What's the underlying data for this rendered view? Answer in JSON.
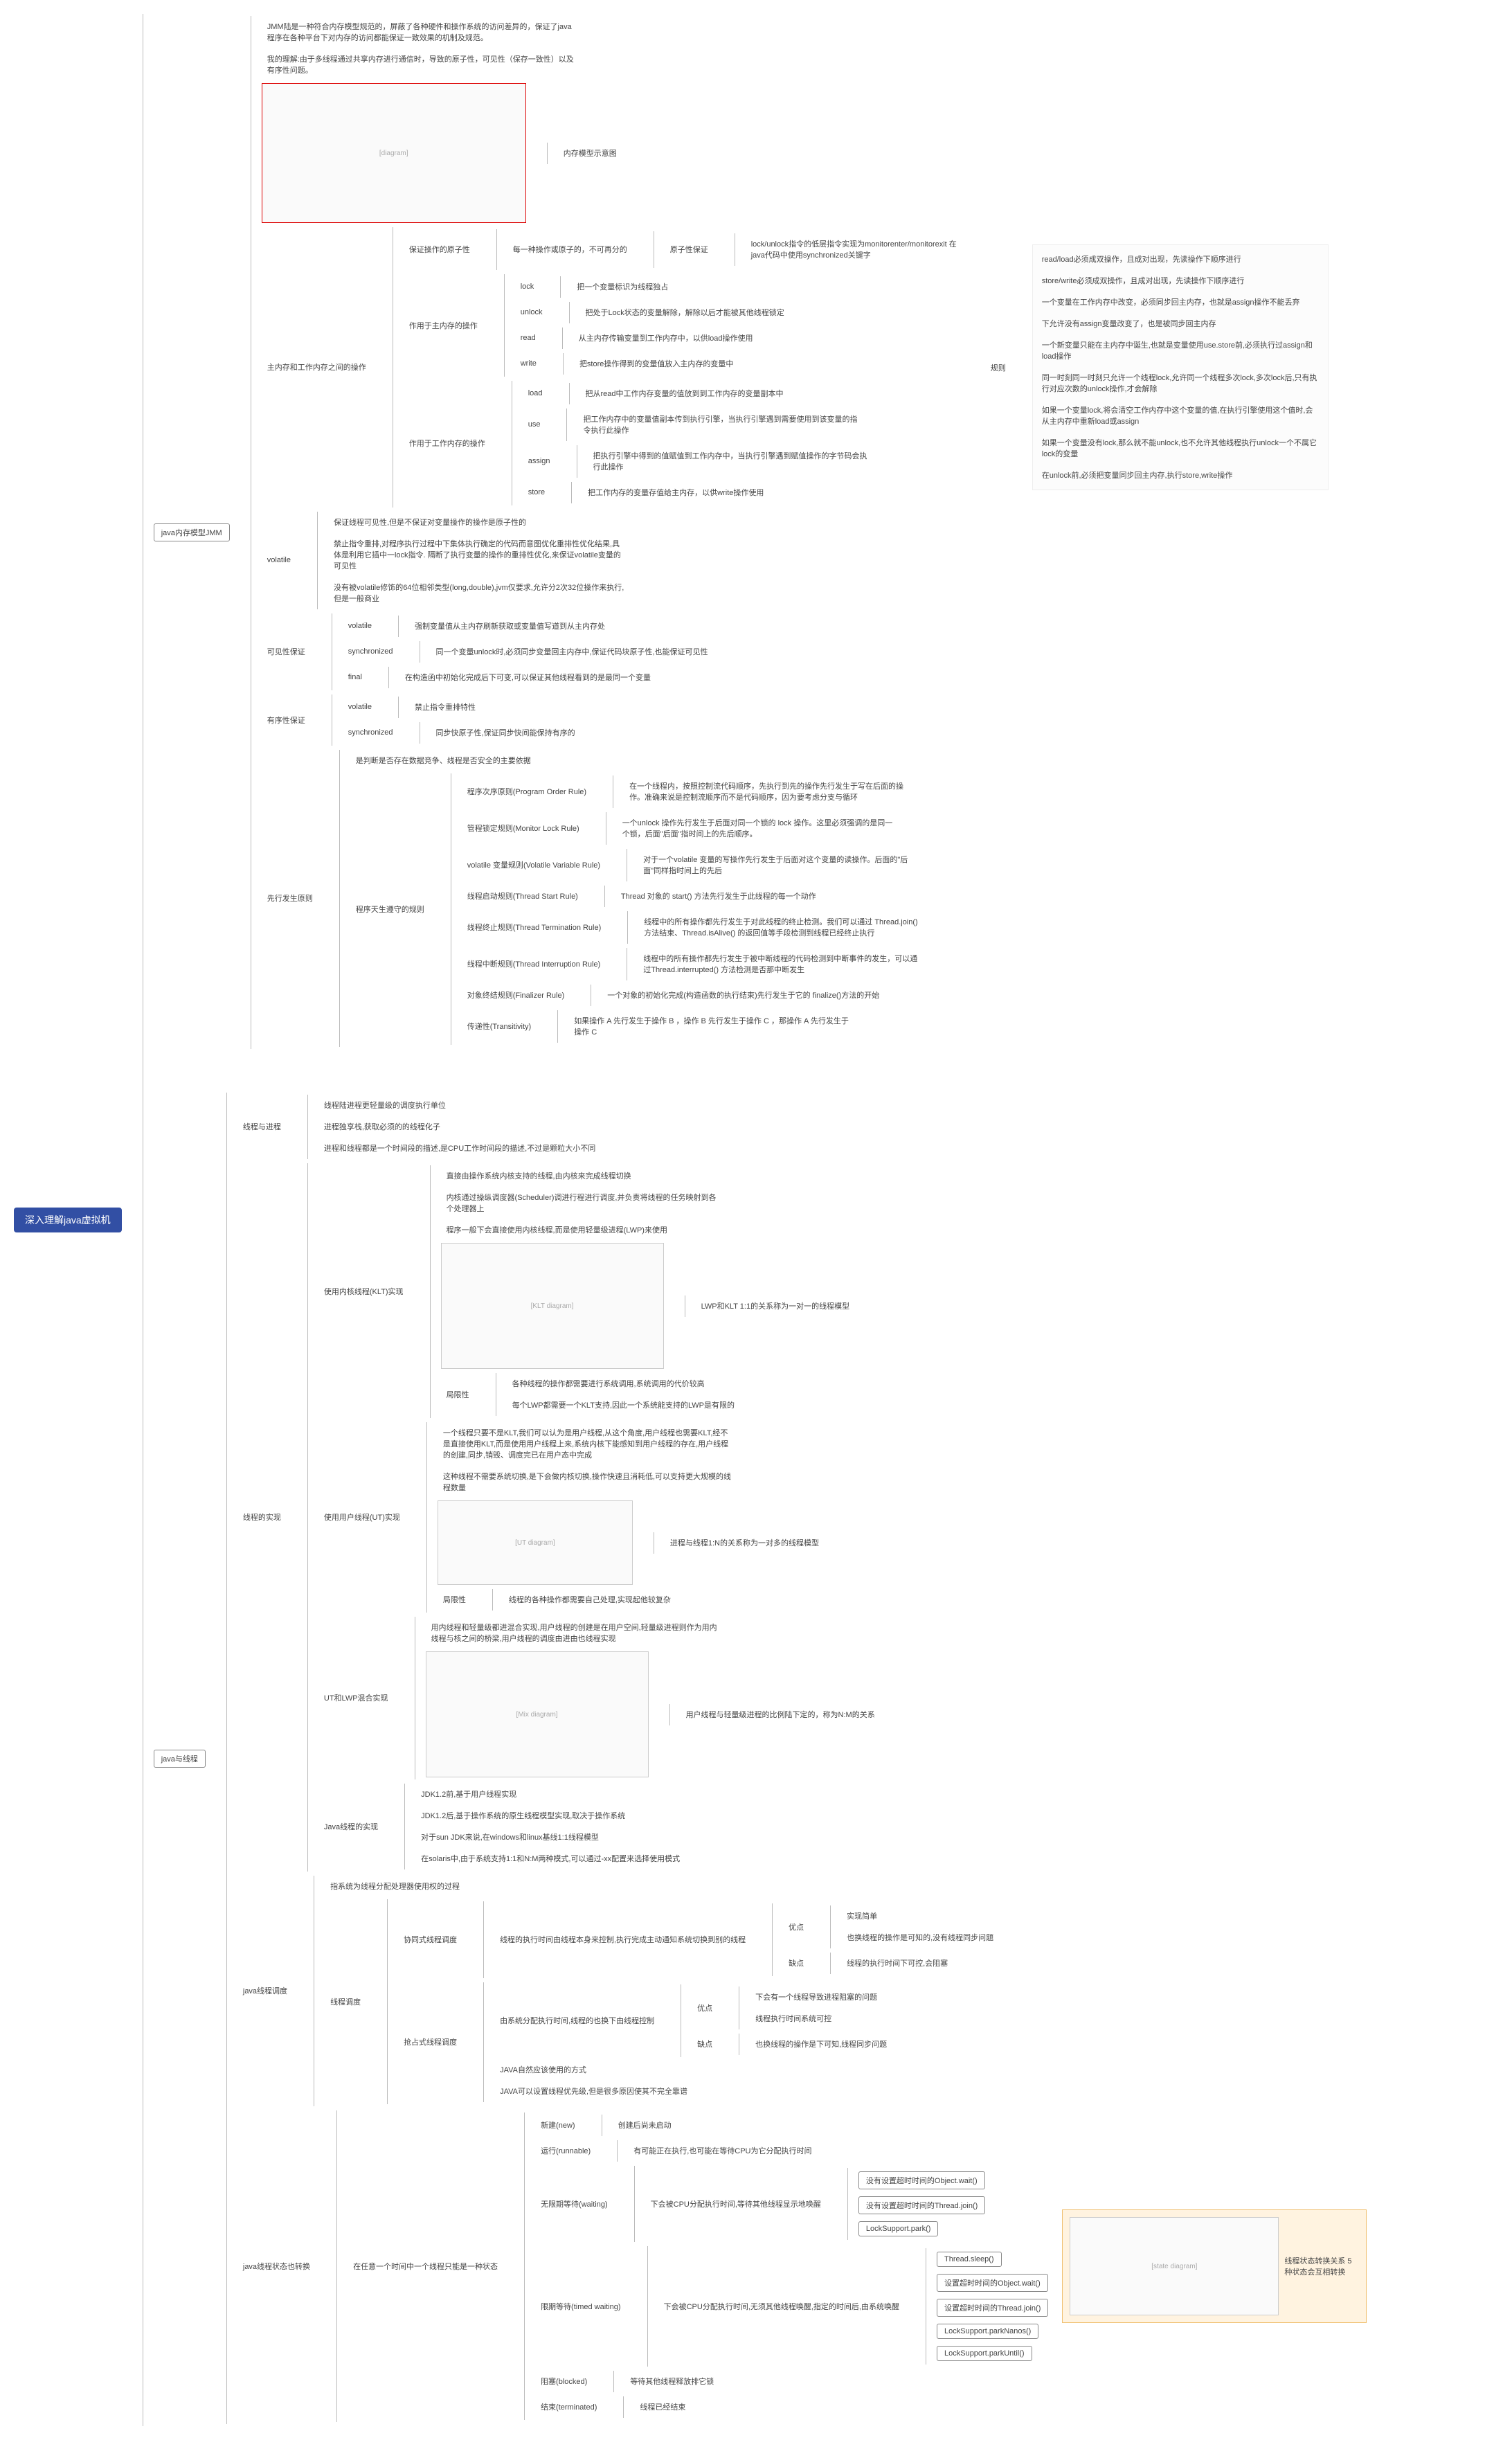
{
  "root": "深入理解java虚拟机",
  "c1": {
    "title": "java内存模型JMM",
    "desc1": "JMM陆是一种符合内存模型规范的，屏蔽了各种硬件和操作系统的访问差异的，保证了java程序在各种平台下对内存的访问都能保证一致效果的机制及规范。",
    "desc2": "我的理解:由于多线程通过共享内存进行通信时，导致的原子性，可见性（保存一致性）以及有序性问题。",
    "img1": "内存模型示意图",
    "c1_1": {
      "title": "主内存和工作内存之间的操作",
      "c1_1_1": {
        "title": "保证操作的原子性",
        "text": "每一种操作或原子的，不可再分的",
        "c1": "原子性保证",
        "c2": "lock/unlock指令的低层指令实现为monitorenter/monitorexit 在java代码中使用synchronized关键字"
      },
      "c1_1_2": {
        "title": "作用于主内存的操作",
        "lock": "把一个变量标识为线程独占",
        "unlock": "把处于Lock状态的变量解除，解除以后才能被其他线程锁定",
        "read": "从主内存传输变量到工作内存中，以供load操作使用",
        "write": "把store操作得到的变量值放入主内存的变量中"
      },
      "c1_1_3": {
        "title": "作用于工作内存的操作",
        "load": "把从read中工作内存变量的值放到到工作内存的变量副本中",
        "use": "把工作内存中的变量值副本传到执行引擎，当执行引擎遇到需要使用到该变量的指令执行此操作",
        "assign": "把执行引擎中得到的值赋值到工作内存中，当执行引擎遇到赋值操作的字节码会执行此操作",
        "store": "把工作内存的变量存值给主内存，以供write操作使用"
      },
      "rules": {
        "title": "规则",
        "r1": "read/load必须成双操作，且成对出现，先读操作下顺序进行",
        "r2": "store/write必须成双操作，且成对出现，先读操作下顺序进行",
        "r3": "一个变量在工作内存中改变，必须同步回主内存，也就是assign操作不能丢弃",
        "r4": "下允许没有assign变量改变了，也是被同步回主内存",
        "r5": "一个新变量只能在主内存中诞生,也就是变量使用use.store前,必须执行过assign和load操作",
        "r6": "同一时刻同一时刻只允许一个线程lock,允许同一个线程多次lock,多次lock后,只有执行对应次数的unlock操作,才会解除",
        "r7": "如果一个变量lock,将会清空工作内存中这个变量的值,在执行引擎使用这个值时,会从主内存中重新load或assign",
        "r8": "如果一个变量没有lock,那么就不能unlock,也不允许其他线程执行unlock一个不属它lock的变量",
        "r9": "在unlock前,必须把变量同步回主内存,执行store,write操作"
      }
    },
    "c1_2": {
      "title": "volatile",
      "t1": "保证线程可见性,但是不保证对变量操作的操作是原子性的",
      "t2": "禁止指令重排,对程序执行过程中下集体执行确定的代码而意图优化重排性优化结果,具体是利用它插中一lock指令. 隔断了执行变量的操作的重排性优化,来保证volatile变量的可见性",
      "t3": "没有被volatile修饰的64位相邻类型(long,double),jvm仅要求,允许分2次32位操作来执行,但是一般商业"
    },
    "c1_3": {
      "title": "可见性保证",
      "v": "强制变量值从主内存刷新获取或变量值写道到从主内存处",
      "s": "同一个变量unlock时,必须同步变量回主内存中,保证代码块原子性,也能保证可见性",
      "f": "在构造函中初始化完成后下可变,可以保证其他线程看到的是最同一个变量"
    },
    "c1_4": {
      "title": "有序性保证",
      "v": "禁止指令重排特性",
      "s": "同步快原子性,保证同步快间能保持有序的"
    },
    "c1_5": {
      "title": "先行发生原则",
      "desc": "是判断是否存在数据竞争、线程是否安全的主要依据",
      "sub": "程序天生遵守的规则",
      "r1": {
        "n": "程序次序原则(Program Order Rule)",
        "t": "在一个线程内，按照控制流代码顺序，先执行到先的操作先行发生于写在后面的操作。准确来说是控制流顺序而不是代码顺序，因为要考虑分支与循环"
      },
      "r2": {
        "n": "管程锁定规则(Monitor Lock Rule)",
        "t": "一个unlock 操作先行发生于后面对同一个锁的 lock 操作。这里必须强调的是同一个锁，后面\"后面\"指时间上的先后顺序。"
      },
      "r3": {
        "n": "volatile 变量规则(Volatile Variable Rule)",
        "t": "对于一个volatile 变量的写操作先行发生于后面对这个变量的读操作。后面的\"后面\"同样指时间上的先后"
      },
      "r4": {
        "n": "线程启动规则(Thread Start Rule)",
        "t": "Thread 对象的 start() 方法先行发生于此线程的每一个动作"
      },
      "r5": {
        "n": "线程终止规则(Thread Termination Rule)",
        "t": "线程中的所有操作都先行发生于对此线程的终止检测。我们可以通过 Thread.join() 方法结束、Thread.isAlive() 的返回值等手段检测到线程已经终止执行"
      },
      "r6": {
        "n": "线程中断规则(Thread Interruption Rule)",
        "t": "线程中的所有操作都先行发生于被中断线程的代码检测到中断事件的发生，可以通过Thread.interrupted() 方法检测是否那中断发生"
      },
      "r7": {
        "n": "对象终结规则(Finalizer Rule)",
        "t": "一个对象的初始化完成(构造函数的执行结束)先行发生于它的 finalize()方法的开始"
      },
      "r8": {
        "n": "传递性(Transitivity)",
        "t": "如果操作 A 先行发生于操作 B ，操作 B 先行发生于操作 C ，那操作 A 先行发生于操作 C"
      }
    }
  },
  "c2": {
    "title": "java与线程",
    "c2_1": {
      "title": "线程与进程",
      "t1": "线程陆进程更轻量级的调度执行单位",
      "t2": "进程独享栈,获取必须的的线程化子",
      "t3": "进程和线程都是一个时间段的描述,是CPU工作时间段的描述,不过是颗粒大小不同"
    },
    "c2_2": {
      "title": "线程的实现",
      "klt": {
        "title": "使用内核线程(KLT)实现",
        "t1": "直接由操作系统内核支持的线程,由内核来完成线程切换",
        "t2": "内核通过操纵调度器(Scheduler)调进行程进行调度,并负责将线程的任务映射到各个处理器上",
        "t3": "程序一般下会直接使用内核线程,而是使用轻量级进程(LWP)来使用",
        "img": "LWP和KLT 1:1的关系称为一对一的线程模型",
        "dis": {
          "title": "局限性",
          "t1": "各种线程的操作都需要进行系统调用,系统调用的代价较高",
          "t2": "每个LWP都需要一个KLT支持,因此一个系统能支持的LWP是有限的"
        }
      },
      "ut": {
        "title": "使用用户线程(UT)实现",
        "t1": "一个线程只要不是KLT,我们可以认为是用户线程,从这个角度,用户线程也需要KLT,经不是直接使用KLT,而是使用用户线程上来,系统内核下能感知到用户线程的存在,用户线程的创建,同步,销毁、调度完已在用户态中完成",
        "t2": "这种线程不需要系统切换,是下会做内核切换,操作快速且消耗低,可以支持更大规模的线程数量",
        "img": "进程与线程1:N的关系称为一对多的线程模型",
        "dis": "线程的各种操作都需要自己处理,实现起他较复杂"
      },
      "mix": {
        "title": "UT和LWP混合实现",
        "t": "用内线程和轻量级都进混合实现,用户线程的创建是在用户空间,轻量级进程则作为用内线程与核之间的桥梁,用户线程的调度由进由也线程实现",
        "img": "用户线程与轻量级进程的比例陆下定的，称为N:M的关系"
      },
      "java": {
        "title": "Java线程的实现",
        "t1": "JDK1.2前,基于用户线程实现",
        "t2": "JDK1.2后,基于操作系统的原生线程模型实现,取决于操作系统",
        "t3": "对于sun JDK来说,在windows和linux基线1:1线程模型",
        "t4": "在solaris中,由于系统支持1:1和N:M两种模式,可以通过-xx配置来选择使用模式"
      }
    },
    "c2_3": {
      "title": "java线程调度",
      "desc": "指系统为线程分配处理器使用权的过程",
      "sub": "线程调度",
      "coop": {
        "n": "协同式线程调度",
        "t": "线程的执行时间由线程本身来控制,执行完成主动通知系统切换到别的线程",
        "adv": {
          "n": "优点",
          "t1": "实现简单",
          "t2": "也换线程的操作是可知的,没有线程同步问题"
        },
        "dis": {
          "n": "缺点",
          "t": "线程的执行时间下可控,会阻塞"
        }
      },
      "preempt": {
        "n": "抢占式线程调度",
        "t": "由系统分配执行时间,线程的也换下由线程控制",
        "adv": {
          "n": "优点",
          "t1": "下会有一个线程导致进程阻塞的问题",
          "t2": "线程执行时间系统可控"
        },
        "dis": {
          "n": "缺点",
          "t": "也换线程的操作是下可知,线程同步问题"
        },
        "ext1": "JAVA自然应该使用的方式",
        "ext2": "JAVA可以设置线程优先级,但是很多原因使其不完全靠谱"
      }
    },
    "c2_4": {
      "title": "java线程状态也转换",
      "desc": "在任意一个时间中一个线程只能是一种状态",
      "new": {
        "n": "新建(new)",
        "t": "创建后尚未启动"
      },
      "run": {
        "n": "运行(runnable)",
        "t": "有可能正在执行,也可能在等待CPU为它分配执行时间"
      },
      "wait": {
        "n": "无限期等待(waiting)",
        "t": "下会被CPU分配执行时间,等待其他线程显示地唤醒",
        "m1": "没有设置超时时间的Object.wait()",
        "m2": "没有设置超时时间的Thread.join()",
        "m3": "LockSupport.park()"
      },
      "twait": {
        "n": "限期等待(timed waiting)",
        "t": "下会被CPU分配执行时间,无须其他线程唤醒,指定的时间后,由系统唤醒",
        "m1": "Thread.sleep()",
        "m2": "设置超时时间的Object.wait()",
        "m3": "设置超时时间的Thread.join()",
        "m4": "LockSupport.parkNanos()",
        "m5": "LockSupport.parkUntil()"
      },
      "block": {
        "n": "阻塞(blocked)",
        "t": "等待其他线程释放排它锁"
      },
      "term": {
        "n": "结束(terminated)",
        "t": "线程已经结束"
      },
      "img": "线程状态转换关系 5种状态会互相转换"
    }
  }
}
